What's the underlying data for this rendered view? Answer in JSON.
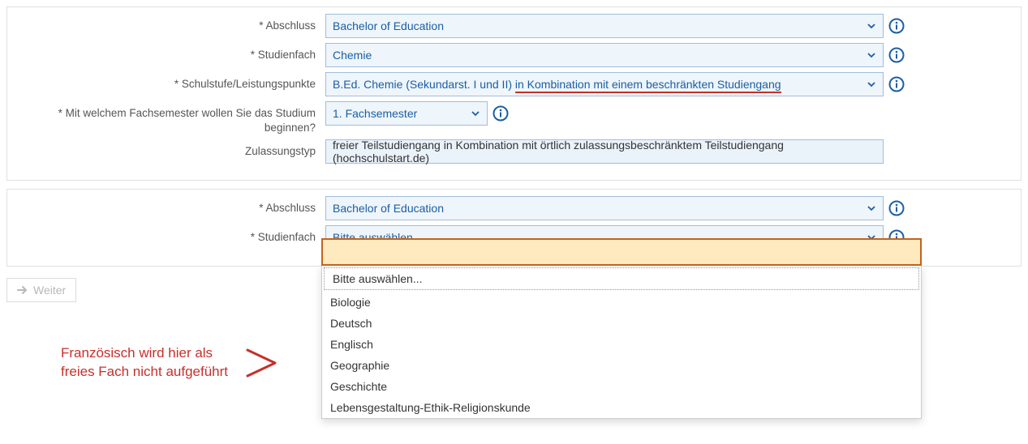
{
  "section1": {
    "abschluss": {
      "label": "* Abschluss",
      "value": "Bachelor of Education"
    },
    "studienfach": {
      "label": "* Studienfach",
      "value": "Chemie"
    },
    "schulstufe": {
      "label": "* Schulstufe/Leistungspunkte",
      "value_pre": "B.Ed. Chemie (Sekundarst. I und II) ",
      "value_underlined": "in Kombination mit einem beschränkten Studiengang"
    },
    "fachsemester": {
      "label": "* Mit welchem Fachsemester wollen Sie das Studium beginnen?",
      "value": "1. Fachsemester"
    },
    "zulassungstyp": {
      "label": "Zulassungstyp",
      "value": "freier Teilstudiengang in Kombination mit örtlich zulassungsbeschränktem Teilstudiengang (hochschulstart.de)"
    }
  },
  "section2": {
    "abschluss": {
      "label": "* Abschluss",
      "value": "Bachelor of Education"
    },
    "studienfach": {
      "label": "* Studienfach",
      "value": "Bitte auswählen..."
    }
  },
  "dropdown": {
    "filter_value": "",
    "options": [
      "Bitte auswählen...",
      "Biologie",
      "Deutsch",
      "Englisch",
      "Geographie",
      "Geschichte",
      "Lebensgestaltung-Ethik-Religionskunde"
    ]
  },
  "annotation": {
    "line1": "Französisch wird hier als",
    "line2": "freies Fach nicht aufgeführt"
  },
  "buttons": {
    "weiter": "Weiter"
  }
}
